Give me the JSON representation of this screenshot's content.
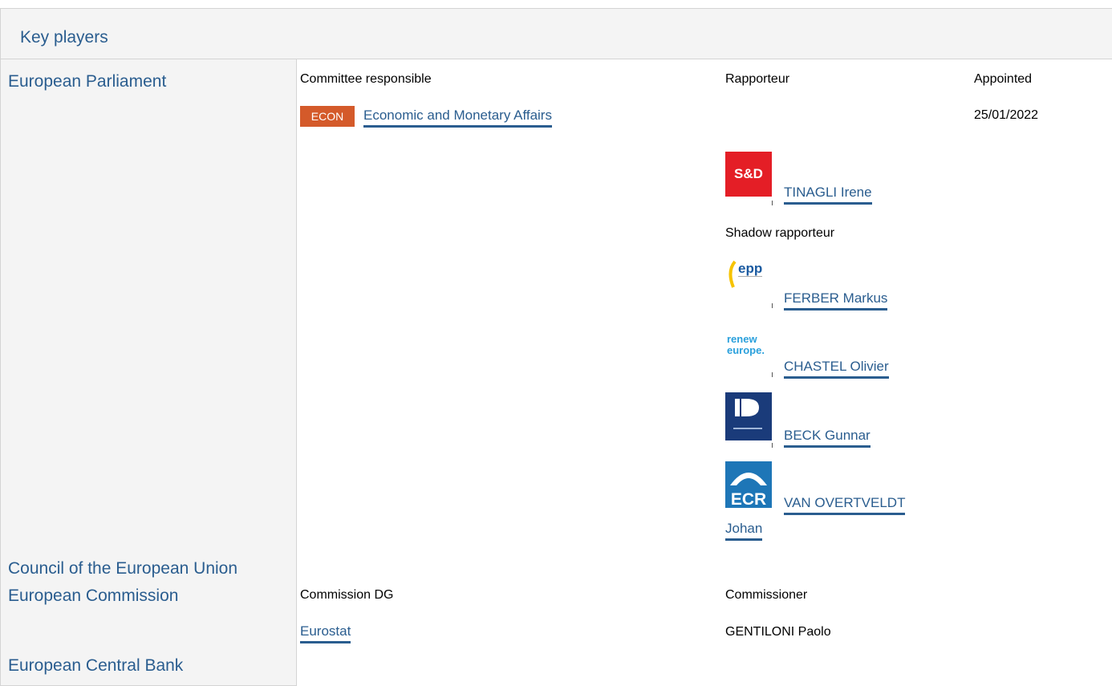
{
  "header": {
    "title": "Key players"
  },
  "entities": {
    "parliament": "European Parliament",
    "council": "Council of the European Union",
    "commission": "European Commission",
    "ecb": "European Central Bank"
  },
  "parliament": {
    "committee_header": "Committee responsible",
    "rapporteur_header": "Rapporteur",
    "appointed_header": "Appointed",
    "committee_badge": "ECON",
    "committee_name": "Economic and Monetary Affairs",
    "appointed_date": "25/01/2022",
    "rapporteur": {
      "group_logo_text": "S&D",
      "name": "TINAGLI Irene"
    },
    "shadow_header": "Shadow rapporteur",
    "shadows": [
      {
        "group_logo_text": "epp",
        "name": "FERBER Markus"
      },
      {
        "group_logo_text": "renew europe.",
        "name": "CHASTEL Olivier"
      },
      {
        "group_logo_text": "ID",
        "name": "BECK Gunnar"
      },
      {
        "group_logo_text": "ECR",
        "name_line1": "VAN OVERTVELDT",
        "name_line2": "Johan"
      }
    ]
  },
  "commission": {
    "dg_header": "Commission DG",
    "commissioner_header": "Commissioner",
    "dg_name": "Eurostat",
    "commissioner_name": "GENTILONI Paolo"
  },
  "colors": {
    "link": "#2a5d8f",
    "badge": "#d45a2a",
    "panel_bg": "#f4f4f4"
  }
}
